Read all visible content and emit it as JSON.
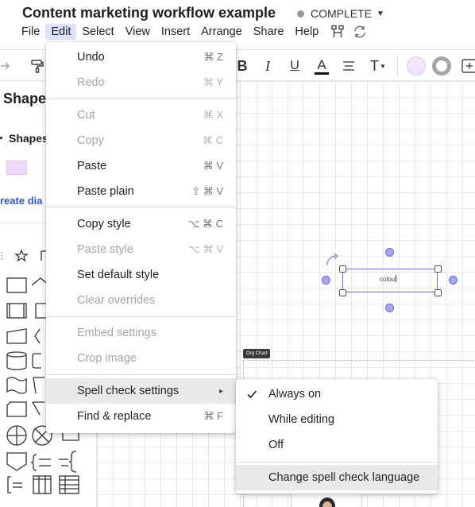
{
  "document": {
    "title": "Content marketing workflow example",
    "status": "COMPLETE"
  },
  "menubar": {
    "items": [
      "File",
      "Edit",
      "Select",
      "View",
      "Insert",
      "Arrange",
      "Share",
      "Help"
    ],
    "active": "Edit",
    "icons": [
      "presentation-network-icon",
      "sync-icon"
    ]
  },
  "toolbar": {
    "bold": "B",
    "italic": "I",
    "underline": "U",
    "font_color": "A",
    "text_size": "T",
    "icons": [
      "redo-arrow-icon",
      "format-painter-icon",
      "align-center-icon",
      "fill-color-icon",
      "line-style-icon",
      "add-shape-icon"
    ],
    "fill_color": "#f3e4fb"
  },
  "left_panel": {
    "title": "Shape",
    "section": "Shapes",
    "link": "reate dia",
    "swatch_color": "#f0d8fb"
  },
  "edit_menu": {
    "items": [
      {
        "label": "Undo",
        "shortcut": "⌘ Z",
        "enabled": true
      },
      {
        "label": "Redo",
        "shortcut": "⌘ Y",
        "enabled": false
      },
      {
        "label": "Cut",
        "shortcut": "⌘ X",
        "enabled": false
      },
      {
        "label": "Copy",
        "shortcut": "⌘ C",
        "enabled": false
      },
      {
        "label": "Paste",
        "shortcut": "⌘ V",
        "enabled": true
      },
      {
        "label": "Paste plain",
        "shortcut": "⇧ ⌘ V",
        "enabled": true
      },
      {
        "label": "Copy style",
        "shortcut": "⌥ ⌘ C",
        "enabled": true
      },
      {
        "label": "Paste style",
        "shortcut": "⌥ ⌘ V",
        "enabled": false
      },
      {
        "label": "Set default style",
        "shortcut": "",
        "enabled": true
      },
      {
        "label": "Clear overrides",
        "shortcut": "",
        "enabled": false
      },
      {
        "label": "Embed settings",
        "shortcut": "",
        "enabled": false
      },
      {
        "label": "Crop image",
        "shortcut": "",
        "enabled": false
      },
      {
        "label": "Spell check settings",
        "shortcut": "▸",
        "enabled": true,
        "highlighted": true
      },
      {
        "label": "Find & replace",
        "shortcut": "⌘ F",
        "enabled": true
      }
    ]
  },
  "spell_submenu": {
    "items": [
      {
        "label": "Always on",
        "checked": true
      },
      {
        "label": "While editing",
        "checked": false
      },
      {
        "label": "Off",
        "checked": false
      },
      {
        "label": "Change spell check language",
        "checked": false,
        "highlighted": true
      }
    ]
  },
  "canvas": {
    "shape_text": "colou",
    "org_chart_tag": "Org Chart",
    "selection_color": "#6b6bd6"
  }
}
